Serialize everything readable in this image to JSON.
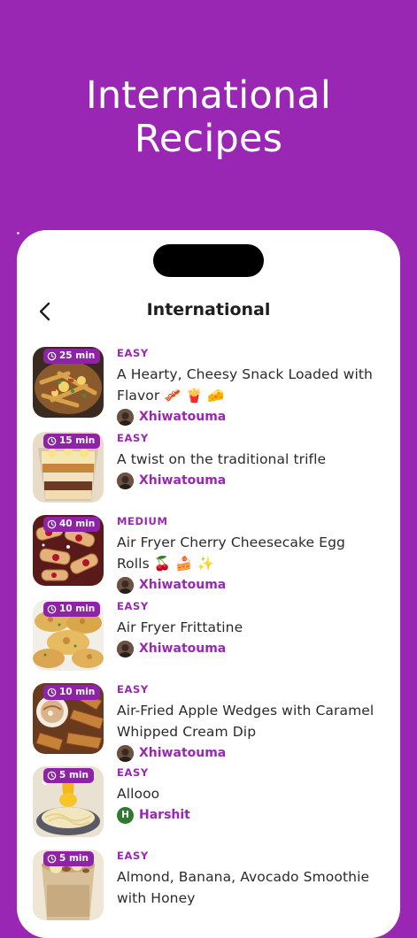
{
  "hero": {
    "line1": "International",
    "line2": "Recipes"
  },
  "nav": {
    "title": "International"
  },
  "recipes": [
    {
      "time": "25 min",
      "difficulty": "EASY",
      "title_lines": [
        "A Hearty, Cheesy Snack Loaded with",
        "Flavor 🥓 🍟 🧀"
      ],
      "author": "Xhiwatouma",
      "avatar_letter": ""
    },
    {
      "time": "15 min",
      "difficulty": "EASY",
      "title_lines": [
        "A twist on the traditional trifle"
      ],
      "author": "Xhiwatouma",
      "avatar_letter": ""
    },
    {
      "time": "40 min",
      "difficulty": "MEDIUM",
      "title_lines": [
        "Air Fryer Cherry Cheesecake Egg",
        "Rolls 🍒 🍰 ✨"
      ],
      "author": "Xhiwatouma",
      "avatar_letter": ""
    },
    {
      "time": "10 min",
      "difficulty": "EASY",
      "title_lines": [
        "Air Fryer Frittatine"
      ],
      "author": "Xhiwatouma",
      "avatar_letter": ""
    },
    {
      "time": "10 min",
      "difficulty": "EASY",
      "title_lines": [
        "Air-Fried Apple Wedges with Caramel",
        "Whipped Cream Dip"
      ],
      "author": "Xhiwatouma",
      "avatar_letter": ""
    },
    {
      "time": "5 min",
      "difficulty": "EASY",
      "title_lines": [
        "Allooo"
      ],
      "author": "Harshit",
      "avatar_letter": "H"
    },
    {
      "time": "5 min",
      "difficulty": "EASY",
      "title_lines": [
        "Almond, Banana, Avocado Smoothie",
        "with Honey"
      ],
      "author": "",
      "avatar_letter": ""
    }
  ]
}
